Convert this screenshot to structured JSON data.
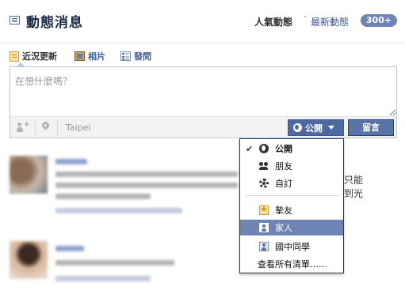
{
  "header": {
    "title": "動態消息",
    "hot_label": "人氣動態",
    "separator": "·",
    "latest_label": "最新動態",
    "badge": "300+"
  },
  "composer": {
    "tabs": [
      {
        "label": "近況更新",
        "icon": "status-icon",
        "active": true
      },
      {
        "label": "相片",
        "icon": "photo-icon",
        "active": false
      },
      {
        "label": "發問",
        "icon": "question-icon",
        "active": false
      }
    ],
    "placeholder": "在想什麼嗎？",
    "location": "Taipei",
    "privacy_label": "公開",
    "post_label": "留言"
  },
  "privacy_menu": {
    "items": [
      {
        "label": "公開",
        "icon": "globe-icon",
        "checked": true
      },
      {
        "label": "朋友",
        "icon": "friends-icon",
        "checked": false
      },
      {
        "label": "自訂",
        "icon": "gear-icon",
        "checked": false
      },
      {
        "label": "摯友",
        "icon": "star-list-icon",
        "checked": false
      },
      {
        "label": "家人",
        "icon": "family-list-icon",
        "checked": false,
        "highlighted": true
      },
      {
        "label": "國中同學",
        "icon": "classmates-list-icon",
        "checked": false
      }
    ],
    "see_all": "查看所有清單……",
    "check_mark": "✔"
  },
  "feed_peek": {
    "line1": "只能",
    "line2": "到光"
  },
  "colors": {
    "brand": "#3b5998",
    "button": "#5b74a8",
    "highlight": "#6d84b4"
  }
}
